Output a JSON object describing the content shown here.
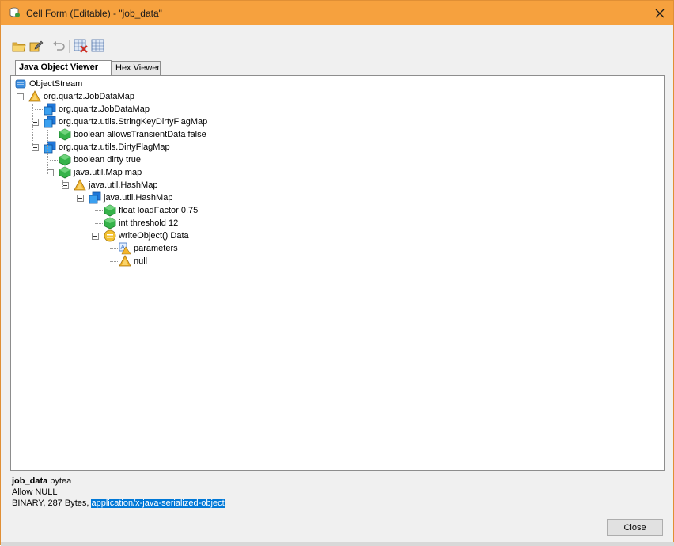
{
  "window": {
    "title": "Cell Form (Editable) - \"job_data\"",
    "title_bar_color": "#f6a13e"
  },
  "toolbar": {
    "buttons": [
      {
        "name": "open-icon"
      },
      {
        "name": "edit-icon"
      },
      {
        "name": "undo-icon"
      },
      {
        "name": "clear-grid-icon"
      },
      {
        "name": "grid-icon"
      }
    ]
  },
  "tabs": [
    {
      "label": "Java Object Viewer",
      "active": true
    },
    {
      "label": "Hex Viewer",
      "active": false
    }
  ],
  "tree": {
    "nodes": [
      {
        "label": "ObjectStream",
        "icon": "stream-icon"
      },
      {
        "label": "org.quartz.JobDataMap",
        "icon": "warning-cone-icon"
      },
      {
        "label": "org.quartz.JobDataMap",
        "icon": "class-icon"
      },
      {
        "label": "org.quartz.utils.StringKeyDirtyFlagMap",
        "icon": "class-icon"
      },
      {
        "label": "boolean allowsTransientData false",
        "icon": "field-icon"
      },
      {
        "label": "org.quartz.utils.DirtyFlagMap",
        "icon": "class-icon"
      },
      {
        "label": "boolean dirty true",
        "icon": "field-icon"
      },
      {
        "label": "java.util.Map map",
        "icon": "field-icon"
      },
      {
        "label": "java.util.HashMap",
        "icon": "warning-cone-icon"
      },
      {
        "label": "java.util.HashMap",
        "icon": "class-icon"
      },
      {
        "label": "float loadFactor 0.75",
        "icon": "field-icon"
      },
      {
        "label": "int threshold 12",
        "icon": "field-icon"
      },
      {
        "label": "writeObject() Data",
        "icon": "method-icon"
      },
      {
        "label": "parameters",
        "icon": "parameters-icon"
      },
      {
        "label": "null",
        "icon": "warning-cone-icon"
      }
    ]
  },
  "column_info": {
    "name": "job_data",
    "type": "bytea",
    "nullability": "Allow NULL",
    "summary_prefix": "BINARY, 287 Bytes, ",
    "mime_type": "application/x-java-serialized-object"
  },
  "footer": {
    "close_label": "Close"
  }
}
